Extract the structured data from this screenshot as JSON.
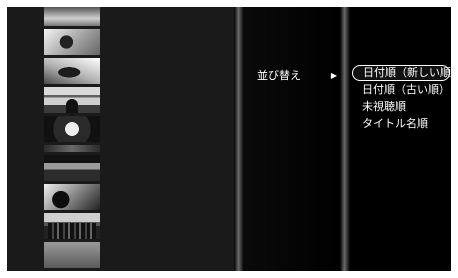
{
  "menu": {
    "category_label": "並び替え",
    "arrow_glyph": "▶",
    "options": [
      {
        "label": "日付順（新しい順）",
        "selected": true
      },
      {
        "label": "日付順（古い順）",
        "selected": false
      },
      {
        "label": "未視聴順",
        "selected": false
      },
      {
        "label": "タイトル名順",
        "selected": false
      }
    ]
  },
  "colors": {
    "background": "#000000",
    "text": "#ffffff",
    "highlight_border": "#ffffff"
  }
}
